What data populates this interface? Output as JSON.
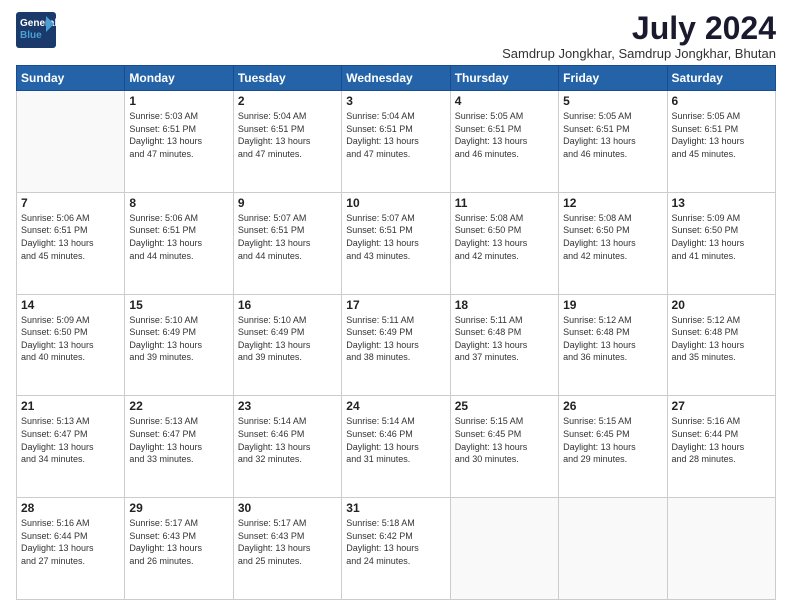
{
  "logo": {
    "general": "General",
    "blue": "Blue"
  },
  "title": "July 2024",
  "location": "Samdrup Jongkhar, Samdrup Jongkhar, Bhutan",
  "days": [
    "Sunday",
    "Monday",
    "Tuesday",
    "Wednesday",
    "Thursday",
    "Friday",
    "Saturday"
  ],
  "weeks": [
    [
      {
        "day": "",
        "content": ""
      },
      {
        "day": "1",
        "content": "Sunrise: 5:03 AM\nSunset: 6:51 PM\nDaylight: 13 hours\nand 47 minutes."
      },
      {
        "day": "2",
        "content": "Sunrise: 5:04 AM\nSunset: 6:51 PM\nDaylight: 13 hours\nand 47 minutes."
      },
      {
        "day": "3",
        "content": "Sunrise: 5:04 AM\nSunset: 6:51 PM\nDaylight: 13 hours\nand 47 minutes."
      },
      {
        "day": "4",
        "content": "Sunrise: 5:05 AM\nSunset: 6:51 PM\nDaylight: 13 hours\nand 46 minutes."
      },
      {
        "day": "5",
        "content": "Sunrise: 5:05 AM\nSunset: 6:51 PM\nDaylight: 13 hours\nand 46 minutes."
      },
      {
        "day": "6",
        "content": "Sunrise: 5:05 AM\nSunset: 6:51 PM\nDaylight: 13 hours\nand 45 minutes."
      }
    ],
    [
      {
        "day": "7",
        "content": "Sunrise: 5:06 AM\nSunset: 6:51 PM\nDaylight: 13 hours\nand 45 minutes."
      },
      {
        "day": "8",
        "content": "Sunrise: 5:06 AM\nSunset: 6:51 PM\nDaylight: 13 hours\nand 44 minutes."
      },
      {
        "day": "9",
        "content": "Sunrise: 5:07 AM\nSunset: 6:51 PM\nDaylight: 13 hours\nand 44 minutes."
      },
      {
        "day": "10",
        "content": "Sunrise: 5:07 AM\nSunset: 6:51 PM\nDaylight: 13 hours\nand 43 minutes."
      },
      {
        "day": "11",
        "content": "Sunrise: 5:08 AM\nSunset: 6:50 PM\nDaylight: 13 hours\nand 42 minutes."
      },
      {
        "day": "12",
        "content": "Sunrise: 5:08 AM\nSunset: 6:50 PM\nDaylight: 13 hours\nand 42 minutes."
      },
      {
        "day": "13",
        "content": "Sunrise: 5:09 AM\nSunset: 6:50 PM\nDaylight: 13 hours\nand 41 minutes."
      }
    ],
    [
      {
        "day": "14",
        "content": "Sunrise: 5:09 AM\nSunset: 6:50 PM\nDaylight: 13 hours\nand 40 minutes."
      },
      {
        "day": "15",
        "content": "Sunrise: 5:10 AM\nSunset: 6:49 PM\nDaylight: 13 hours\nand 39 minutes."
      },
      {
        "day": "16",
        "content": "Sunrise: 5:10 AM\nSunset: 6:49 PM\nDaylight: 13 hours\nand 39 minutes."
      },
      {
        "day": "17",
        "content": "Sunrise: 5:11 AM\nSunset: 6:49 PM\nDaylight: 13 hours\nand 38 minutes."
      },
      {
        "day": "18",
        "content": "Sunrise: 5:11 AM\nSunset: 6:48 PM\nDaylight: 13 hours\nand 37 minutes."
      },
      {
        "day": "19",
        "content": "Sunrise: 5:12 AM\nSunset: 6:48 PM\nDaylight: 13 hours\nand 36 minutes."
      },
      {
        "day": "20",
        "content": "Sunrise: 5:12 AM\nSunset: 6:48 PM\nDaylight: 13 hours\nand 35 minutes."
      }
    ],
    [
      {
        "day": "21",
        "content": "Sunrise: 5:13 AM\nSunset: 6:47 PM\nDaylight: 13 hours\nand 34 minutes."
      },
      {
        "day": "22",
        "content": "Sunrise: 5:13 AM\nSunset: 6:47 PM\nDaylight: 13 hours\nand 33 minutes."
      },
      {
        "day": "23",
        "content": "Sunrise: 5:14 AM\nSunset: 6:46 PM\nDaylight: 13 hours\nand 32 minutes."
      },
      {
        "day": "24",
        "content": "Sunrise: 5:14 AM\nSunset: 6:46 PM\nDaylight: 13 hours\nand 31 minutes."
      },
      {
        "day": "25",
        "content": "Sunrise: 5:15 AM\nSunset: 6:45 PM\nDaylight: 13 hours\nand 30 minutes."
      },
      {
        "day": "26",
        "content": "Sunrise: 5:15 AM\nSunset: 6:45 PM\nDaylight: 13 hours\nand 29 minutes."
      },
      {
        "day": "27",
        "content": "Sunrise: 5:16 AM\nSunset: 6:44 PM\nDaylight: 13 hours\nand 28 minutes."
      }
    ],
    [
      {
        "day": "28",
        "content": "Sunrise: 5:16 AM\nSunset: 6:44 PM\nDaylight: 13 hours\nand 27 minutes."
      },
      {
        "day": "29",
        "content": "Sunrise: 5:17 AM\nSunset: 6:43 PM\nDaylight: 13 hours\nand 26 minutes."
      },
      {
        "day": "30",
        "content": "Sunrise: 5:17 AM\nSunset: 6:43 PM\nDaylight: 13 hours\nand 25 minutes."
      },
      {
        "day": "31",
        "content": "Sunrise: 5:18 AM\nSunset: 6:42 PM\nDaylight: 13 hours\nand 24 minutes."
      },
      {
        "day": "",
        "content": ""
      },
      {
        "day": "",
        "content": ""
      },
      {
        "day": "",
        "content": ""
      }
    ]
  ]
}
